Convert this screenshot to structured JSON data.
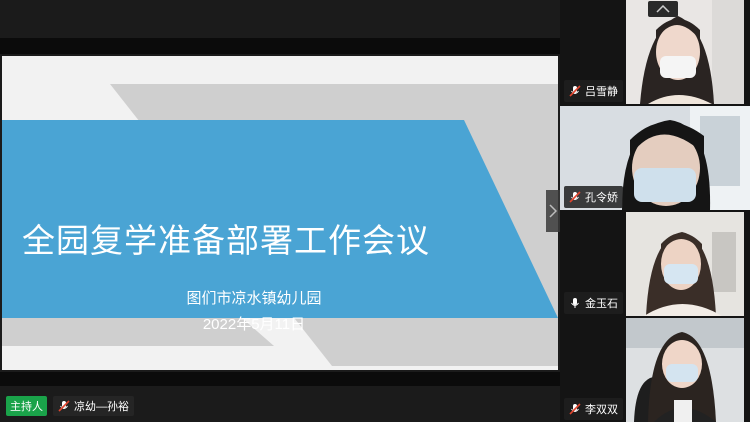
{
  "slide": {
    "title": "全园复学准备部署工作会议",
    "subtitle_line1": "图们市凉水镇幼儿园",
    "subtitle_line2": "2022年5月11日"
  },
  "host": {
    "badge": "主持人",
    "name": "凉幼—孙裕",
    "mic_icon": "mic-muted-icon"
  },
  "participants": [
    {
      "name": "吕雪静",
      "mic_icon": "mic-muted-icon"
    },
    {
      "name": "孔令娇",
      "mic_icon": "mic-muted-icon"
    },
    {
      "name": "金玉石",
      "mic_icon": "mic-icon"
    },
    {
      "name": "李双双",
      "mic_icon": "mic-muted-icon"
    }
  ],
  "colors": {
    "slide_blue": "#4aa4d4",
    "slide_gray": "#cfcfcf",
    "host_badge": "#1aa34a",
    "muted_red": "#e0452f"
  }
}
